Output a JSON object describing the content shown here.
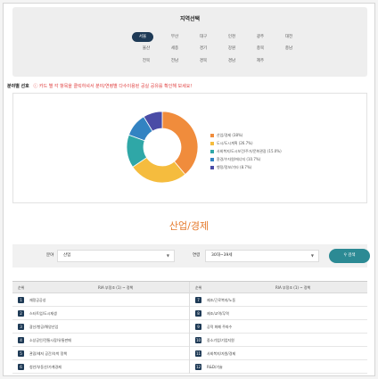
{
  "region": {
    "title": "지역선택",
    "rows": [
      [
        "서울",
        "부산",
        "대구",
        "인천",
        "광주",
        "대전"
      ],
      [
        "울산",
        "세종",
        "경기",
        "강원",
        "충북",
        "충남"
      ],
      [
        "전북",
        "전남",
        "경북",
        "경남",
        "제주"
      ]
    ],
    "selected": "서울"
  },
  "preference": {
    "label": "분야별 선호",
    "hint": "ⓘ 카드 별 각 항목을 클릭하셔서 분야/연령별 다수이용된 공실 공유를 확인해 보세요!"
  },
  "chart_data": {
    "type": "pie",
    "subtype": "donut",
    "labels": [
      "산업/경제",
      "도시/도시계획",
      "사회복지/도시보건/주거",
      "환경/수자원/에너지",
      "행정/정보/기타"
    ],
    "values": [
      38.9,
      26.7,
      15.0,
      10.7,
      8.7
    ],
    "legend_texts": [
      "산업/경제 (38%)",
      "도시/도시계획 (26.7%)",
      "사회복지/도시보건/주거/문화관광 (15.0%)",
      "환경/수자원/에너지 (10.7%)",
      "행정/정보/기타 (8.7%)"
    ],
    "colors": [
      "#f08c3c",
      "#f5bc3e",
      "#2fa7a7",
      "#3383c2",
      "#4a4ca6"
    ]
  },
  "section_title": "산업/경제",
  "filters": {
    "field1_label": "분야",
    "field1_value": "산업",
    "field2_label": "연령",
    "field2_value": "30대~39세",
    "search_label": "검색"
  },
  "table": {
    "left": {
      "headers": [
        "순위",
        "RIA 부정조 (1) ~ 정책"
      ],
      "rows": [
        {
          "rank": "1",
          "text": "재정공공성"
        },
        {
          "rank": "2",
          "text": "스타트업/도시재생"
        },
        {
          "rank": "3",
          "text": "광산/항공/해양산업"
        },
        {
          "rank": "4",
          "text": "소상공인/전통시장/유통판매"
        },
        {
          "rank": "5",
          "text": "관광/레저 공간/숙박 정책"
        },
        {
          "rank": "6",
          "text": "청년/부동산/가계경제"
        }
      ]
    },
    "right": {
      "headers": [
        "순위",
        "RIA 부정조 (1) ~ 정책"
      ],
      "rows": [
        {
          "rank": "7",
          "text": "제조/근로복지/노동"
        },
        {
          "rank": "8",
          "text": "제조/교역/무역"
        },
        {
          "rank": "9",
          "text": "공적 화폐 주파수"
        },
        {
          "rank": "10",
          "text": "중소기업/기업지원"
        },
        {
          "rank": "11",
          "text": "사회복지/자원/경제"
        },
        {
          "rank": "12",
          "text": "R&D/기술"
        }
      ]
    }
  }
}
